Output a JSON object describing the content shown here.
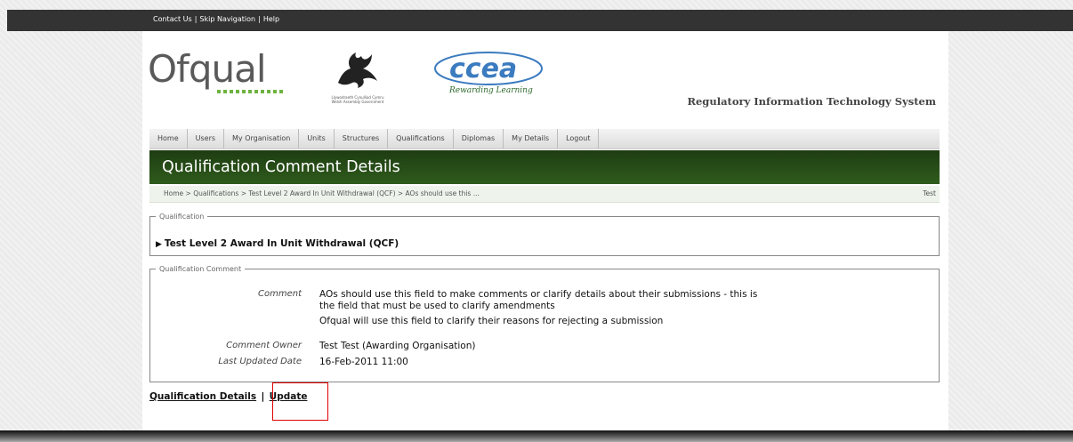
{
  "top_links": [
    "Contact Us",
    "Skip Navigation",
    "Help"
  ],
  "logos": {
    "ofqual": "Ofqual",
    "welsh_caption_1": "Llywodraeth Cynulliad Cymru",
    "welsh_caption_2": "Welsh Assembly Government",
    "ccea_word": "ccea",
    "ccea_tagline": "Rewarding Learning"
  },
  "system_title": "Regulatory Information Technology System",
  "nav": [
    "Home",
    "Users",
    "My Organisation",
    "Units",
    "Structures",
    "Qualifications",
    "Diplomas",
    "My Details",
    "Logout"
  ],
  "page_title": "Qualification Comment Details",
  "breadcrumb": "Home > Qualifications > Test Level 2 Award In Unit Withdrawal (QCF) > AOs should use this ...",
  "current_user": "Test",
  "qualification": {
    "legend": "Qualification",
    "name": "Test Level 2 Award In Unit Withdrawal (QCF)"
  },
  "comment": {
    "legend": "Qualification Comment",
    "comment_label": "Comment",
    "comment_line1": "AOs should use this field to make comments or clarify details about their submissions - this is",
    "comment_line2": "the field that must be used to clarify amendments",
    "comment_line3": "Ofqual will use this field to clarify their reasons for rejecting a submission",
    "owner_label": "Comment Owner",
    "owner_value": "Test Test (Awarding Organisation)",
    "updated_label": "Last Updated Date",
    "updated_value": "16-Feb-2011 11:00"
  },
  "actions": {
    "details_link": "Qualification Details",
    "separator": "|",
    "update_link": "Update"
  },
  "colors": {
    "title_bar": "#2a5018",
    "highlight": "#e00000",
    "ofqual_dots": "#6db33f"
  }
}
